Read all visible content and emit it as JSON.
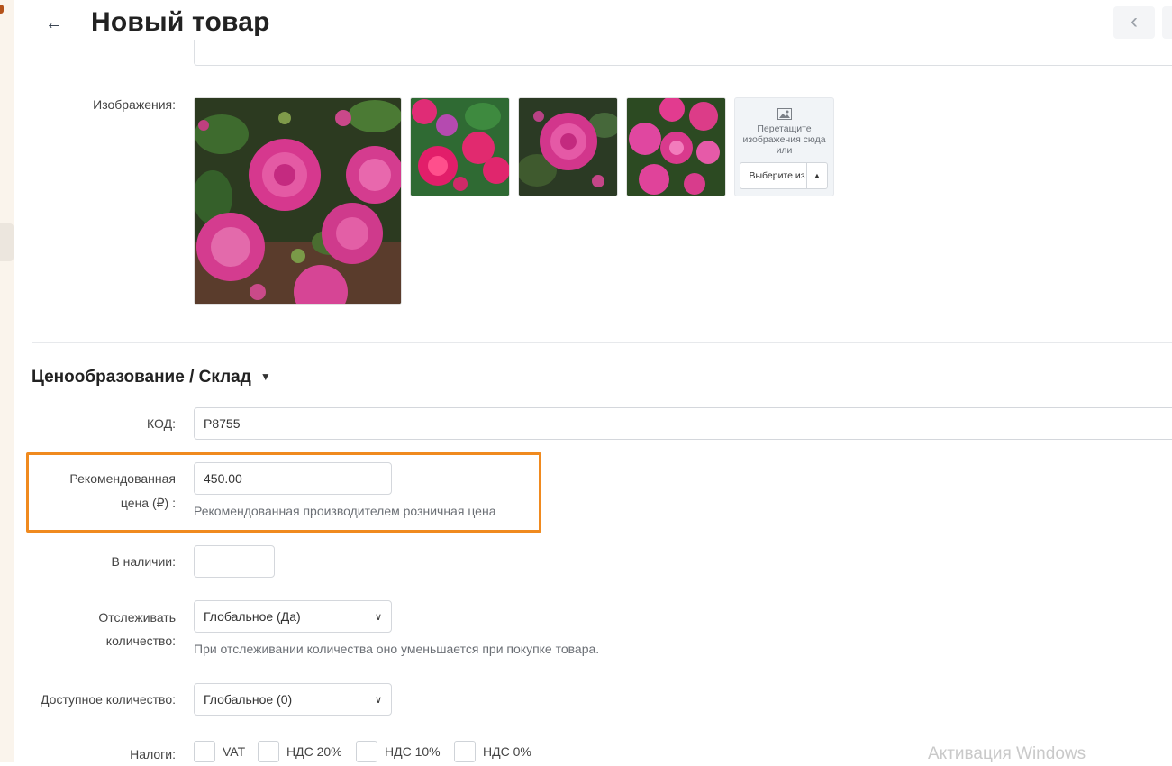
{
  "header": {
    "back_icon": "←",
    "title": "Новый товар",
    "prev_icon": "‹"
  },
  "images": {
    "label": "Изображения:",
    "dropzone": {
      "icon": "image-icon",
      "text": "Перетащите изображения сюда или",
      "button_label": "Выберите из",
      "button_caret": "▲"
    }
  },
  "pricing": {
    "section_title": "Ценообразование / Склад",
    "caret": "▼",
    "code": {
      "label": "КОД:",
      "value": "P8755"
    },
    "recommended_price": {
      "label_line1": "Рекомендованная",
      "label_line2": "цена (₽) :",
      "value": "450.00",
      "help": "Рекомендованная производителем розничная цена"
    },
    "in_stock": {
      "label": "В наличии:",
      "value": ""
    },
    "track_quantity": {
      "label_line1": "Отслеживать",
      "label_line2": "количество:",
      "value": "Глобальное (Да)",
      "help": "При отслеживании количества оно уменьшается при покупке товара."
    },
    "available_quantity": {
      "label": "Доступное количество:",
      "value": "Глобальное (0)"
    },
    "taxes": {
      "label": "Налоги:",
      "options": [
        "VAT",
        "НДС 20%",
        "НДС 10%",
        "НДС 0%"
      ]
    }
  },
  "colors": {
    "accent_highlight": "#f08a1f"
  },
  "system": {
    "watermark": "Активация Windows"
  }
}
